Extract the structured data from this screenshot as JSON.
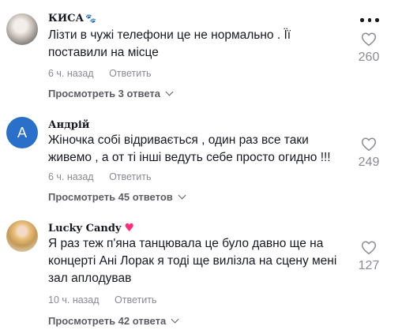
{
  "comments": [
    {
      "username": "КИСА",
      "username_decor": "🐾",
      "text": "Лізти в чужі телефони це не нормально . Її поставили на місце",
      "time": "6 ч. назад",
      "reply_label": "Ответить",
      "view_replies": "Просмотреть 3 ответа",
      "likes": "260",
      "avatar": "photo"
    },
    {
      "username": "Андрій",
      "avatar_letter": "A",
      "text": "Жіночка собі відривається , один раз все таки живемо , а от ті інші ведуть себе просто огидно !!!",
      "time": "6 ч. назад",
      "reply_label": "Ответить",
      "view_replies": "Просмотреть 45 ответов",
      "likes": "249",
      "avatar": "letter"
    },
    {
      "username": "Lucky Candy",
      "username_decor": "♥",
      "text": "Я раз теж п'яна танцювала це було давно ще на концерті Ані Лорак я тоді ще вилізла на сцену мені зал аплодував",
      "time": "10 ч. назад",
      "reply_label": "Ответить",
      "view_replies": "Просмотреть 42 ответа",
      "likes": "127",
      "avatar": "photo"
    }
  ],
  "colors": {
    "text": "#161823",
    "muted": "#8a8b91",
    "view_replies": "#5c5d63",
    "avatar_letter_bg": "#2a6fc9",
    "heart": "#fe2c7a"
  },
  "icons": {
    "more": "more-horizontal-icon",
    "like": "heart-outline-icon",
    "chevron": "chevron-down-icon"
  }
}
